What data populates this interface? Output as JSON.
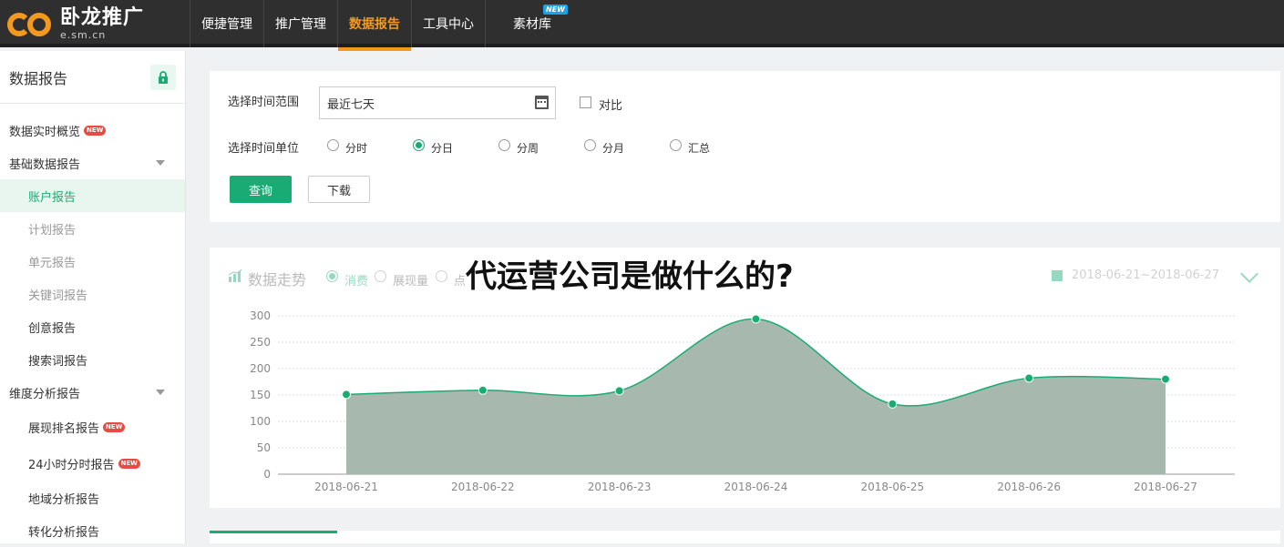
{
  "logo": {
    "name": "卧龙推广",
    "domain": "e.sm.cn"
  },
  "nav": {
    "items": [
      {
        "label": "便捷管理"
      },
      {
        "label": "推广管理"
      },
      {
        "label": "数据报告",
        "active": true
      },
      {
        "label": "工具中心"
      },
      {
        "label": "素材库",
        "badge": "NEW"
      }
    ]
  },
  "sidebar": {
    "title": "数据报告",
    "items": [
      {
        "label": "数据实时概览",
        "badge": "NEW"
      },
      {
        "label": "基础数据报告",
        "expandable": true
      },
      {
        "label": "账户报告",
        "sub": true,
        "active": true
      },
      {
        "label": "计划报告",
        "sub": true,
        "dim": true
      },
      {
        "label": "单元报告",
        "sub": true,
        "dim": true
      },
      {
        "label": "关键词报告",
        "sub": true,
        "dim": true
      },
      {
        "label": "创意报告",
        "sub": true
      },
      {
        "label": "搜索词报告",
        "sub": true
      },
      {
        "label": "维度分析报告",
        "expandable": true
      },
      {
        "label": "展现排名报告",
        "sub": true,
        "badge": "NEW"
      },
      {
        "label": "24小时分时报告",
        "sub": true,
        "badge": "NEW"
      },
      {
        "label": "地域分析报告",
        "sub": true
      },
      {
        "label": "转化分析报告",
        "sub": true
      }
    ]
  },
  "filter": {
    "time_range_label": "选择时间范围",
    "time_range_value": "最近七天",
    "compare_label": "对比",
    "time_unit_label": "选择时间单位",
    "units": [
      "分时",
      "分日",
      "分周",
      "分月",
      "汇总"
    ],
    "selected_unit": "分日",
    "query_label": "查询",
    "download_label": "下载"
  },
  "trend": {
    "title": "数据走势",
    "metrics": [
      "消费",
      "展现量",
      "点"
    ],
    "date_range": "2018-06-21~2018-06-27"
  },
  "overlay_title": "代运营公司是做什么的?",
  "colors": {
    "accent": "#1aab74",
    "nav_active": "#f39a1e",
    "area_fill": "#a7b9ae"
  },
  "chart_data": {
    "type": "area",
    "categories": [
      "2018-06-21",
      "2018-06-22",
      "2018-06-23",
      "2018-06-24",
      "2018-06-25",
      "2018-06-26",
      "2018-06-27"
    ],
    "series": [
      {
        "name": "消费",
        "values": [
          151,
          159,
          158,
          294,
          133,
          182,
          180
        ]
      }
    ],
    "ylim": [
      0,
      300
    ],
    "yticks": [
      0,
      50,
      100,
      150,
      200,
      250,
      300
    ],
    "grid": true
  }
}
